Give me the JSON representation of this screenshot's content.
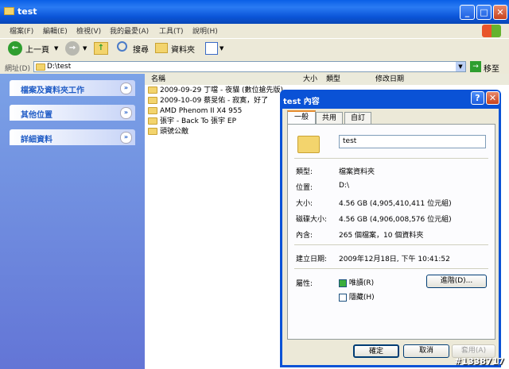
{
  "window": {
    "title": "test",
    "buttons": [
      "_",
      "□",
      "✕"
    ]
  },
  "menu": [
    "檔案(F)",
    "編輯(E)",
    "檢視(V)",
    "我的最愛(A)",
    "工具(T)",
    "說明(H)"
  ],
  "toolbar": {
    "back": "上一頁",
    "search": "搜尋",
    "folders": "資料夾"
  },
  "address": {
    "label": "網址(D)",
    "value": "D:\\test",
    "go": "移至"
  },
  "tasks": [
    "檔案及資料夾工作",
    "其他位置",
    "詳細資料"
  ],
  "columns": {
    "name": "名稱",
    "size": "大小",
    "type": "類型",
    "modified": "修改日期"
  },
  "files": [
    "2009-09-29 丁噹 - 夜貓 (數位搶先版)",
    "2009-10-09 蔡旻佑 - 寂寞，好了",
    "AMD Phenom II X4 955",
    "張宇 - Back To 張宇 EP",
    "頭號公敵"
  ],
  "dialog": {
    "title": "test 內容",
    "tabs": [
      "一般",
      "共用",
      "自訂"
    ],
    "name_value": "test",
    "props": [
      {
        "label": "類型:",
        "value": "檔案資料夾"
      },
      {
        "label": "位置:",
        "value": "D:\\"
      },
      {
        "label": "大小:",
        "value": "4.56 GB (4,905,410,411 位元組)"
      },
      {
        "label": "磁碟大小:",
        "value": "4.56 GB (4,906,008,576 位元組)"
      },
      {
        "label": "內含:",
        "value": "265 個檔案，10 個資料夾"
      }
    ],
    "created": {
      "label": "建立日期:",
      "value": "2009年12月18日, 下午 10:41:52"
    },
    "attributes": {
      "label": "屬性:",
      "readonly": "唯讀(R)",
      "hidden": "隱藏(H)",
      "advanced": "進階(D)..."
    },
    "buttons": {
      "ok": "確定",
      "cancel": "取消",
      "apply": "套用(A)"
    }
  },
  "watermark": "#1338717"
}
